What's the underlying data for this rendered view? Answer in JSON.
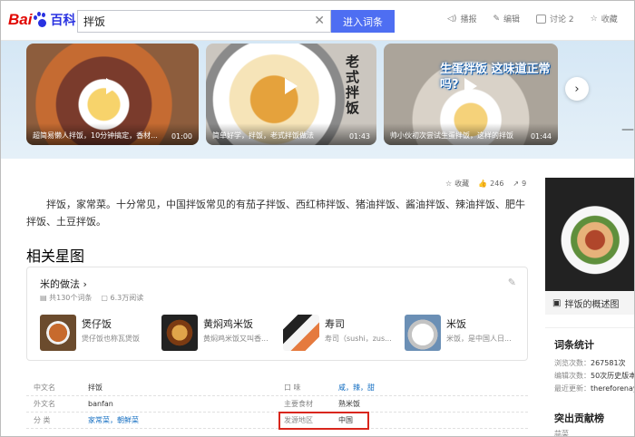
{
  "logo": {
    "bai": "Bai",
    "baike": "百科"
  },
  "search": {
    "value": "拌饭",
    "enter": "进入词条"
  },
  "tools": [
    {
      "icon": "speaker-icon",
      "label": "播报"
    },
    {
      "icon": "pencil-icon",
      "label": "编辑"
    },
    {
      "icon": "chat-icon",
      "label": "讨论 2"
    },
    {
      "icon": "star-icon",
      "label": "收藏"
    }
  ],
  "videos": [
    {
      "caption": "超简易懒人拌饭，10分钟搞定，香材...",
      "duration": "01:00"
    },
    {
      "caption": "简单好学，拌饭，老式拌饭做法",
      "duration": "01:43",
      "overlay": "老式拌饭"
    },
    {
      "caption": "帅小伙初次尝试生蛋拌饭，这样的拌饭",
      "duration": "01:44",
      "overlay": "生蛋拌饭 这味道正常吗?"
    }
  ],
  "actions": {
    "collect": "收藏",
    "likes": "246",
    "shares": "9"
  },
  "summary": "拌饭，家常菜。十分常见，中国拌饭常见的有茄子拌饭、西红柿拌饭、猪油拌饭、酱油拌饭、辣油拌饭、肥牛拌饭、土豆拌饭。",
  "related": {
    "title": "相关星图",
    "card_title": "米的做法",
    "entries": "共130个词条",
    "reads": "6.3万阅读",
    "items": [
      {
        "name": "煲仔饭",
        "desc": "煲仔饭也称瓦煲饭"
      },
      {
        "name": "黄焖鸡米饭",
        "desc": "黄焖鸡米饭又叫香..."
      },
      {
        "name": "寿司",
        "desc": "寿司（sushi，zus..."
      },
      {
        "name": "米饭",
        "desc": "米饭，是中国人日..."
      }
    ]
  },
  "basic": [
    {
      "k1": "中文名",
      "v1": "拌饭",
      "k2": "口 味",
      "v2": "咸，辣，甜"
    },
    {
      "k1": "外文名",
      "v1": "banfan",
      "k2": "主要食材",
      "v2": "熟米饭"
    },
    {
      "k1": "分 类",
      "v1": "家常菜，朝鲜菜",
      "k2": "发源地区",
      "v2": "中国"
    }
  ],
  "side": {
    "caption": "拌饭的概述图",
    "stats_title": "词条统计",
    "views_label": "浏览次数：",
    "views": "267581次",
    "edits_label": "编辑次数：",
    "edits": "50次历史版本",
    "updated_label": "最近更新：",
    "updated": "thereforenay",
    "contrib_title": "突出贡献榜",
    "contrib_note": "蒜菜"
  }
}
